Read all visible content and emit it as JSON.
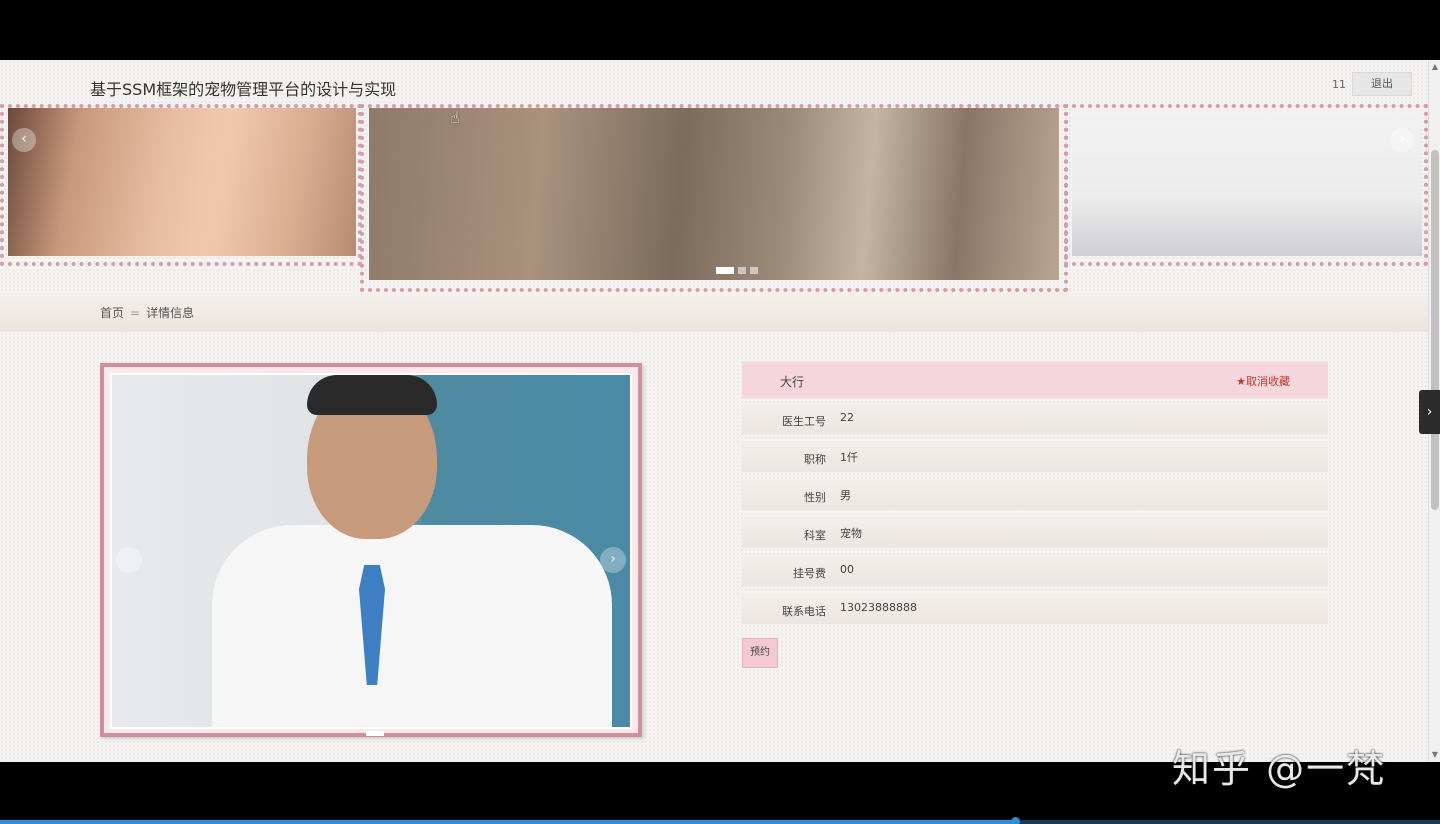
{
  "header": {
    "site_title": "基于SSM框架的宠物管理平台的设计与实现",
    "user_name": "11",
    "logout_label": "退出"
  },
  "carousel": {
    "prev_arrow": "‹",
    "next_arrow": "›",
    "slide_count": 3,
    "active_index": 0
  },
  "breadcrumb": {
    "home": "首页",
    "separator": "=",
    "current": "详情信息"
  },
  "photo_carousel": {
    "prev_arrow": "‹",
    "next_arrow": "›"
  },
  "detail": {
    "name": "大行",
    "favorite_label": "★取消收藏",
    "fields": [
      {
        "label": "医生工号",
        "value": "22"
      },
      {
        "label": "职称",
        "value": "1仟"
      },
      {
        "label": "性别",
        "value": "男"
      },
      {
        "label": "科室",
        "value": "宠物"
      },
      {
        "label": "挂号费",
        "value": "00"
      },
      {
        "label": "联系电话",
        "value": "13023888888"
      }
    ],
    "appoint_label": "预约"
  },
  "side_tab_icon": "›",
  "watermark": "知乎 @一梵",
  "video_progress": 0.705,
  "colors": {
    "accent_pink": "#f5d6dc",
    "frame_pink": "#cf8f9b",
    "favorite_red": "#c0392b"
  }
}
